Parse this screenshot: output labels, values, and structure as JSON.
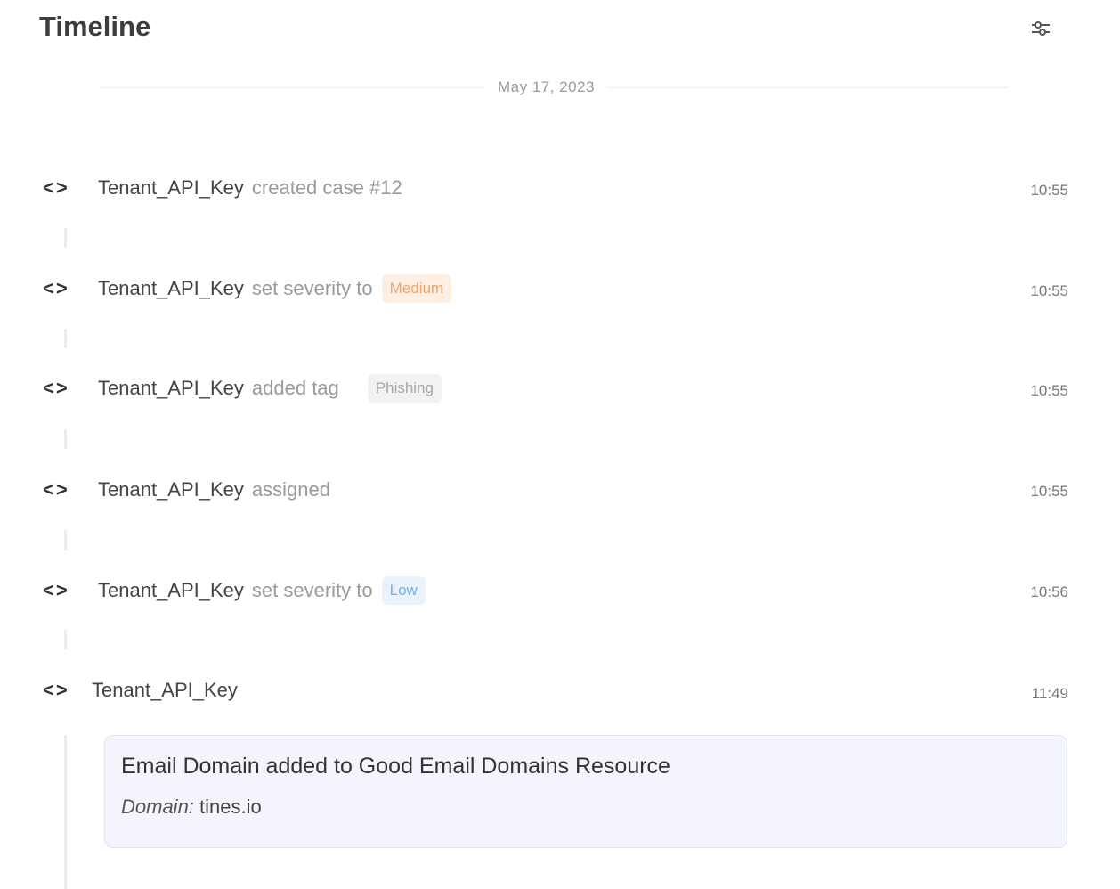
{
  "header": {
    "title": "Timeline",
    "filter_icon": "sliders-icon"
  },
  "date_separator": "May 17, 2023",
  "events": [
    {
      "actor": "Tenant_API_Key",
      "action": "created case #12",
      "time": "10:55"
    },
    {
      "actor": "Tenant_API_Key",
      "action": "set severity to",
      "badge": "Medium",
      "time": "10:55"
    },
    {
      "actor": "Tenant_API_Key",
      "action": "added tag",
      "badge": "Phishing",
      "time": "10:55"
    },
    {
      "actor": "Tenant_API_Key",
      "action": "assigned",
      "time": "10:55"
    },
    {
      "actor": "Tenant_API_Key",
      "action": "set severity to",
      "badge": "Low",
      "time": "10:56"
    },
    {
      "actor": "Tenant_API_Key",
      "time": "11:49",
      "card": {
        "title": "Email Domain added to Good Email Domains Resource",
        "field_label": "Domain:",
        "field_value": "tines.io"
      }
    }
  ],
  "colors": {
    "medium_bg": "#fdefe3",
    "medium_fg": "#f0a46a",
    "low_bg": "#eaf3fd",
    "low_fg": "#6fb0ee",
    "tag_bg": "#f2f2f2",
    "tag_fg": "#a8a8a8"
  }
}
